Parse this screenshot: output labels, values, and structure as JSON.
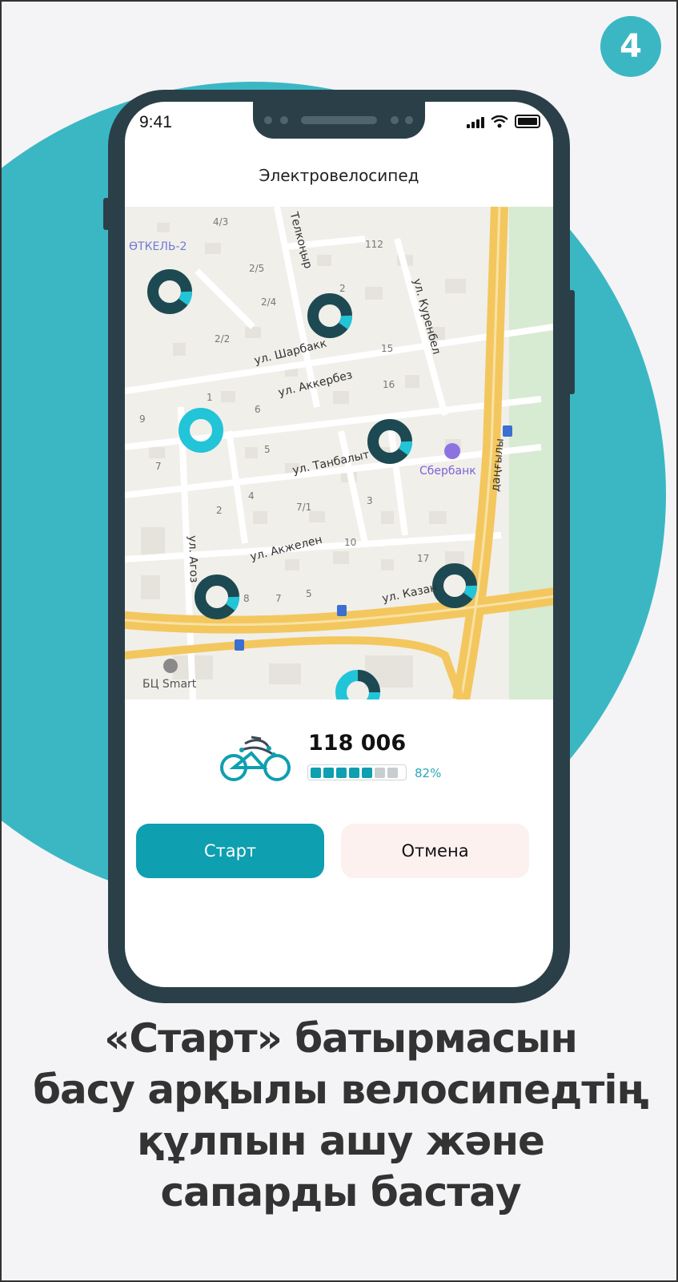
{
  "step_number": "4",
  "status_bar": {
    "time": "9:41"
  },
  "screen": {
    "title": "Электровелосипед"
  },
  "map": {
    "streets": [
      "ул. Шарбакк",
      "ул. Аккербез",
      "ул. Танбалыт",
      "ул. Акжелен",
      "ул. Казан",
      "ул. Агоз",
      "Телкоңыр",
      "ул. Куренбел",
      "даңғылы"
    ],
    "district": "ӨТКЕЛЬ-2",
    "house_numbers": [
      "4/3",
      "112",
      "2/5",
      "2/4",
      "2",
      "2/2",
      "15",
      "16",
      "9",
      "1",
      "6",
      "5",
      "7",
      "4",
      "7/1",
      "3",
      "2",
      "10",
      "17",
      "8",
      "7",
      "5"
    ],
    "poi": {
      "bank": "Сбербанк",
      "office": "БЦ Smart"
    }
  },
  "bike": {
    "id": "118 006",
    "battery_percent_label": "82%",
    "battery_level": 0.82,
    "battery_cells_total": 7,
    "battery_cells_filled": 5
  },
  "buttons": {
    "start_label": "Старт",
    "cancel_label": "Отмена"
  },
  "caption": {
    "line1": "«Старт» батырмасын",
    "line2": "басу арқылы велосипедтің",
    "line3": "құлпын ашу және",
    "line4": "сапарды бастау"
  },
  "colors": {
    "accent": "#0e9fb0",
    "accent_light": "#3bb7c4",
    "phone_frame": "#2b3f48",
    "cancel_bg": "#fdf1f0",
    "marker_dark": "#1d4a52",
    "marker_light": "#22c4d8"
  }
}
